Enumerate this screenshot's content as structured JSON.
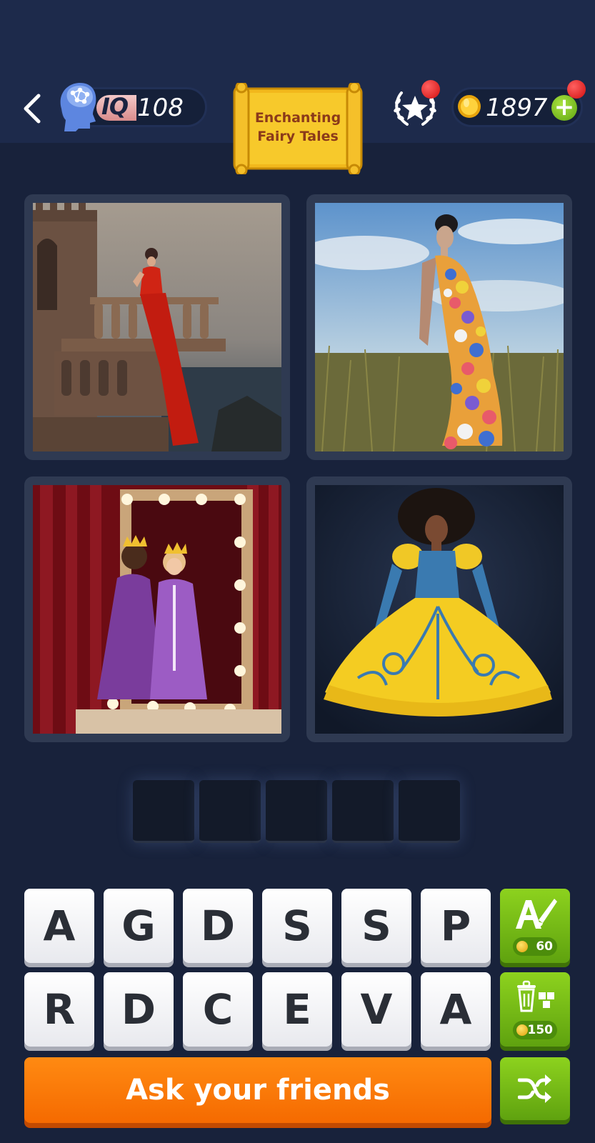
{
  "header": {
    "back_icon": "chevron-left-icon",
    "iq_icon": "brain-head-icon",
    "iq_label": "IQ",
    "iq_value": "108",
    "category_line1": "Enchanting",
    "category_line2": "Fairy Tales",
    "achievements_icon": "laurel-star-icon",
    "coins_icon": "coin-icon",
    "coins": "1897",
    "add_coins_label": "+"
  },
  "puzzle": {
    "images": [
      {
        "icon": "woman-red-gown-on-castle-balcony-photo"
      },
      {
        "icon": "woman-flower-dress-in-field-photo"
      },
      {
        "icon": "girls-in-purple-princess-dresses-at-mirror-photo"
      },
      {
        "icon": "woman-yellow-ball-gown-photo"
      }
    ],
    "answer_length": 5
  },
  "keyboard": {
    "row1": [
      "A",
      "G",
      "D",
      "S",
      "S",
      "P"
    ],
    "row2": [
      "R",
      "D",
      "C",
      "E",
      "V",
      "A"
    ],
    "reveal_letter_cost": "60",
    "remove_letters_cost": "150",
    "reveal_icon": "letter-brush-icon",
    "remove_icon": "trash-blocks-icon",
    "shuffle_icon": "shuffle-icon"
  },
  "actions": {
    "ask_friends_label": "Ask your friends"
  },
  "colors": {
    "background": "#18223b",
    "accent_green": "#6fb816",
    "accent_orange": "#f77d0a",
    "notification_red": "#e01818"
  }
}
